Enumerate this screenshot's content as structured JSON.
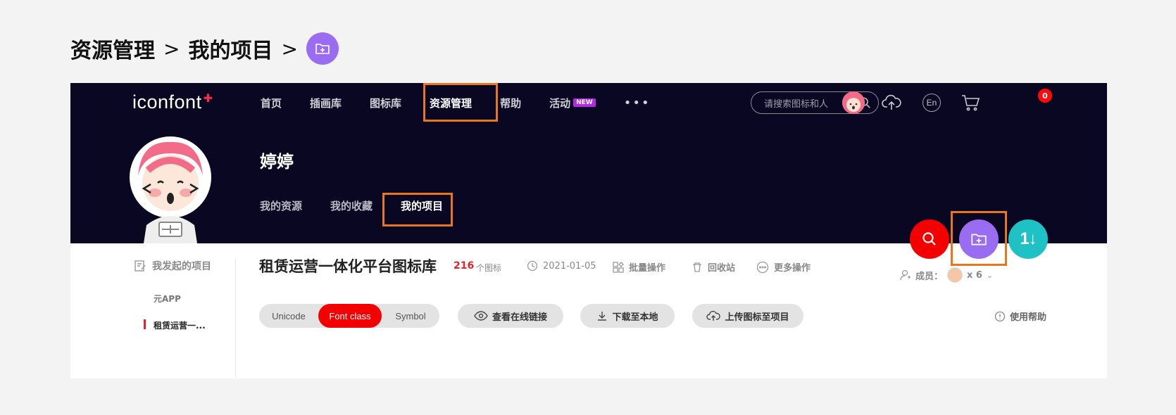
{
  "breadcrumb": {
    "items": [
      "资源管理",
      "我的项目"
    ],
    "separator": ">",
    "icon": "folder-plus-icon"
  },
  "header": {
    "logo": "iconfont",
    "nav": [
      "首页",
      "插画库",
      "图标库",
      "资源管理",
      "帮助",
      "活动"
    ],
    "nav_badge": "NEW",
    "more": "•••",
    "search_placeholder": "请搜索图标和人",
    "lang": "En",
    "cart_count": "0"
  },
  "profile": {
    "name": "婷婷",
    "tabs": [
      "我的资源",
      "我的收藏",
      "我的项目"
    ]
  },
  "sidebar": {
    "title": "我发起的项目",
    "items": [
      "元APP",
      "租赁运营一..."
    ]
  },
  "project": {
    "title": "租赁运营一体化平台图标库",
    "icon_count": "216",
    "icon_unit": "个图标",
    "date": "2021-01-05",
    "actions": [
      "批量操作",
      "回收站",
      "更多操作"
    ],
    "members_label": "成员：",
    "members_count": "x 6"
  },
  "toolbar": {
    "formats": [
      "Unicode",
      "Font class",
      "Symbol"
    ],
    "active_format": "Font class",
    "buttons": [
      "查看在线链接",
      "下载至本地",
      "上传图标至项目"
    ],
    "help": "使用帮助"
  },
  "colors": {
    "header_bg": "#0a0723",
    "accent_red": "#f50000",
    "purple": "#9a6cf2",
    "teal": "#1ec1c4",
    "highlight": "#e8761c"
  }
}
